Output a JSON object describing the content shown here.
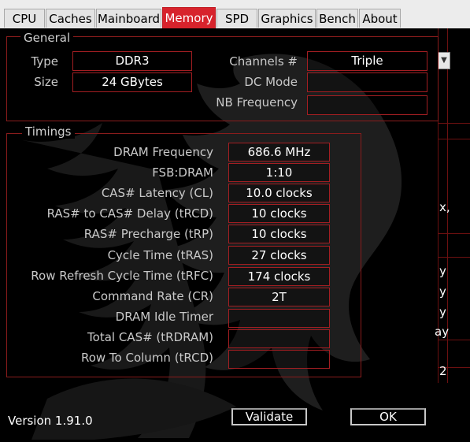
{
  "tabs": [
    {
      "label": "CPU"
    },
    {
      "label": "Caches"
    },
    {
      "label": "Mainboard"
    },
    {
      "label": "Memory"
    },
    {
      "label": "SPD"
    },
    {
      "label": "Graphics"
    },
    {
      "label": "Bench"
    },
    {
      "label": "About"
    }
  ],
  "active_tab": "Memory",
  "general": {
    "title": "General",
    "type_label": "Type",
    "type_value": "DDR3",
    "size_label": "Size",
    "size_value": "24 GBytes",
    "channels_label": "Channels #",
    "channels_value": "Triple",
    "dc_mode_label": "DC Mode",
    "dc_mode_value": "",
    "nb_freq_label": "NB Frequency",
    "nb_freq_value": ""
  },
  "timings": {
    "title": "Timings",
    "rows": [
      {
        "label": "DRAM Frequency",
        "value": "686.6 MHz"
      },
      {
        "label": "FSB:DRAM",
        "value": "1:10"
      },
      {
        "label": "CAS# Latency (CL)",
        "value": "10.0 clocks"
      },
      {
        "label": "RAS# to CAS# Delay (tRCD)",
        "value": "10 clocks"
      },
      {
        "label": "RAS# Precharge (tRP)",
        "value": "10 clocks"
      },
      {
        "label": "Cycle Time (tRAS)",
        "value": "27 clocks"
      },
      {
        "label": "Row Refresh Cycle Time (tRFC)",
        "value": "174 clocks"
      },
      {
        "label": "Command Rate (CR)",
        "value": "2T"
      },
      {
        "label": "DRAM Idle Timer",
        "value": ""
      },
      {
        "label": "Total CAS# (tRDRAM)",
        "value": ""
      },
      {
        "label": "Row To Column (tRCD)",
        "value": ""
      }
    ]
  },
  "right_edge_fragments": [
    "x,",
    "y",
    "y",
    "y",
    "ay",
    "2"
  ],
  "version": "Version 1.91.0",
  "buttons": {
    "validate": "Validate",
    "ok": "OK"
  },
  "colors": {
    "accent": "#d7232c",
    "border": "#a31e22",
    "background": "#000000"
  }
}
